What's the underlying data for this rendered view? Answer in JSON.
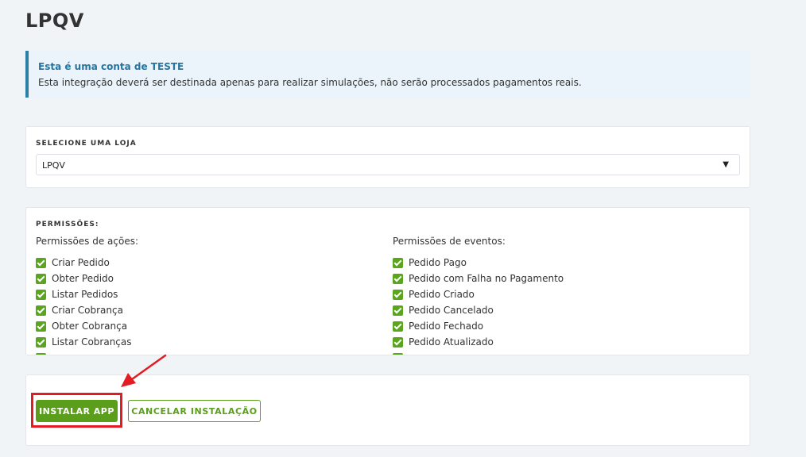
{
  "page": {
    "title": "LPQV"
  },
  "alert": {
    "title": "Esta é uma conta de TESTE",
    "text": "Esta integração deverá ser destinada apenas para realizar simulações, não serão processados pagamentos reais."
  },
  "store_select": {
    "label": "SELECIONE UMA LOJA",
    "selected": "LPQV",
    "caret": "▼"
  },
  "permissions": {
    "label": "PERMISSÕES:",
    "actions": {
      "heading": "Permissões de ações:",
      "items": [
        "Criar Pedido",
        "Obter Pedido",
        "Listar Pedidos",
        "Criar Cobrança",
        "Obter Cobrança",
        "Listar Cobranças"
      ]
    },
    "events": {
      "heading": "Permissões de eventos:",
      "items": [
        "Pedido Pago",
        "Pedido com Falha no Pagamento",
        "Pedido Criado",
        "Pedido Cancelado",
        "Pedido Fechado",
        "Pedido Atualizado"
      ]
    }
  },
  "buttons": {
    "install": "INSTALAR APP",
    "cancel": "CANCELAR INSTALAÇÃO"
  },
  "colors": {
    "accent": "#5b9e1c",
    "alert_border": "#2e7fa6",
    "highlight": "#e31b23"
  },
  "icons": {
    "check": "checkbox-checked-icon",
    "caret": "chevron-down-icon"
  }
}
